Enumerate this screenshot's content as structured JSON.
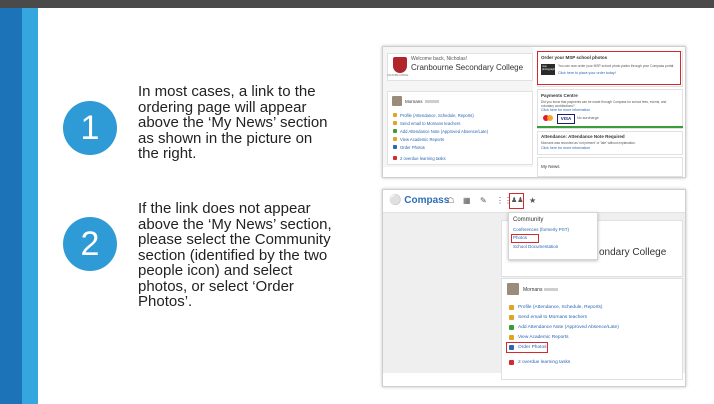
{
  "steps": [
    {
      "number": "1",
      "lines": [
        "In most cases, a link to the",
        "ordering page will appear",
        "above the ‘My News’ section",
        "as shown in the picture on",
        "the right."
      ]
    },
    {
      "number": "2",
      "lines": [
        "If the link does not appear",
        "above the ‘My News’ section,",
        "please select the Community",
        "section (identified by the two",
        "people icon) and select",
        "photos, or select ‘Order",
        "Photos’."
      ]
    }
  ],
  "shot1": {
    "welcome": "Welcome back, Nicholas!",
    "college": "Cranbourne Secondary College",
    "crest_label": "CRANBOURNE",
    "user": "Mornans",
    "links": [
      "Profile (Attendance, Schedule, Reports)",
      "Send email to Mornans teachers",
      "Add Attendance Note (Approved Absence/Late)",
      "View Academic Reports",
      "Order Photos",
      "2 overdue learning tasks"
    ],
    "photo_panel": {
      "title": "Order your MSP school photos",
      "text": "You can now order your MSP school photo packs through your Compass portal.",
      "link": "Click here to place your order today!",
      "brand": "msp photography"
    },
    "payments_panel": {
      "title": "Payments Centre",
      "text1": "Did you know that payments can be made through Compass for school fees, events, and",
      "text2": "voluntary contributions?",
      "link": "Click here for more information",
      "card1": "MasterCard",
      "card2": "VISA",
      "surcharge": "No surcharge"
    },
    "attendance_panel": {
      "title": "Attendance: Attendance Note Required",
      "text": "Mornans was recorded as 'not present' or 'late' without explanation.",
      "link": "Click here for more information"
    },
    "my_news": "My News"
  },
  "shot2": {
    "logo": "Compass",
    "dropdown_title": "Community",
    "dropdown_items": [
      "Conferences (formerly PST)",
      "Photos",
      "School Documentation"
    ],
    "college_partial": "ondary College",
    "user": "Mornans",
    "links": [
      "Profile (Attendance, Schedule, Reports)",
      "Send email to Mornans teachers",
      "Add Attendance Note (Approved Absence/Late)",
      "View Academic Reports",
      "Order Photos",
      "2 overdue learning tasks"
    ]
  },
  "colors": {
    "accent_blue": "#2e9bd6",
    "band_dark": "#1d73b8",
    "highlight_red": "#d4292f"
  }
}
